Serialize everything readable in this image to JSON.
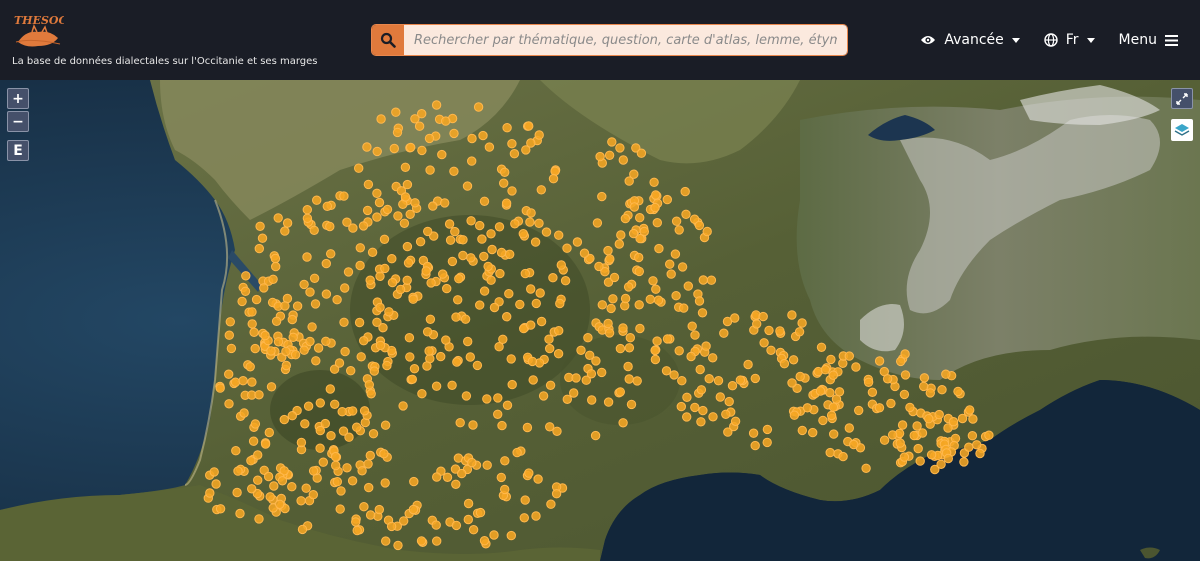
{
  "header": {
    "logo_text": "THESOC",
    "tagline": "La base de données dialectales sur l'Occitanie et ses marges",
    "search": {
      "placeholder": "Rechercher par thématique, question, carte d'atlas, lemme, étymon, loc"
    },
    "nav": {
      "advanced_label": "Avancée",
      "lang_label": "Fr",
      "menu_label": "Menu"
    }
  },
  "map_controls": {
    "zoom_in": "+",
    "zoom_out": "−",
    "e_label": "E"
  },
  "icons": [
    "search-icon",
    "eye-icon",
    "globe-icon",
    "menu-icon",
    "fullscreen-icon",
    "layers-icon"
  ],
  "colors": {
    "navbar": "#1a1d26",
    "accent": "#e07a3c",
    "marker": "#f5a623",
    "marker_stroke": "#ffb84d"
  }
}
